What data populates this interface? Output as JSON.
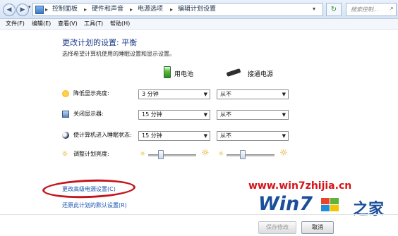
{
  "address_bar": {
    "breadcrumbs": [
      "控制面板",
      "硬件和声音",
      "电源选项",
      "编辑计划设置"
    ],
    "search_placeholder": "搜索控制..."
  },
  "menu": [
    "文件(F)",
    "编辑(E)",
    "查看(V)",
    "工具(T)",
    "帮助(H)"
  ],
  "page": {
    "title": "更改计划的设置: 平衡",
    "subtitle": "选择希望计算机使用的睡眠设置和显示设置。",
    "col_battery": "用电池",
    "col_plugged": "接通电源"
  },
  "rows": [
    {
      "label": "降低显示亮度:",
      "battery": "3 分钟",
      "plugged": "从不",
      "icon": "brightness-icon"
    },
    {
      "label": "关闭显示器:",
      "battery": "15 分钟",
      "plugged": "从不",
      "icon": "monitor-icon"
    },
    {
      "label": "使计算机进入睡眠状态:",
      "battery": "15 分钟",
      "plugged": "从不",
      "icon": "moon-icon"
    }
  ],
  "brightness": {
    "label": "调整计划亮度:",
    "battery_level": 0.25,
    "plugged_level": 0.32
  },
  "links": {
    "advanced": "更改高级电源设置(C)",
    "restore": "还原此计划的默认设置(R)"
  },
  "buttons": {
    "save": "保存修改",
    "cancel": "取消"
  },
  "watermark": {
    "url": "www.win7zhijia.cn",
    "logo": "Win7",
    "suffix": "之家"
  },
  "colors": {
    "title": "#1e3d8a",
    "link": "#1a56b0",
    "highlight_ellipse": "#c4161c",
    "watermark_red": "#d4141a",
    "watermark_blue": "#1b4f9a"
  }
}
